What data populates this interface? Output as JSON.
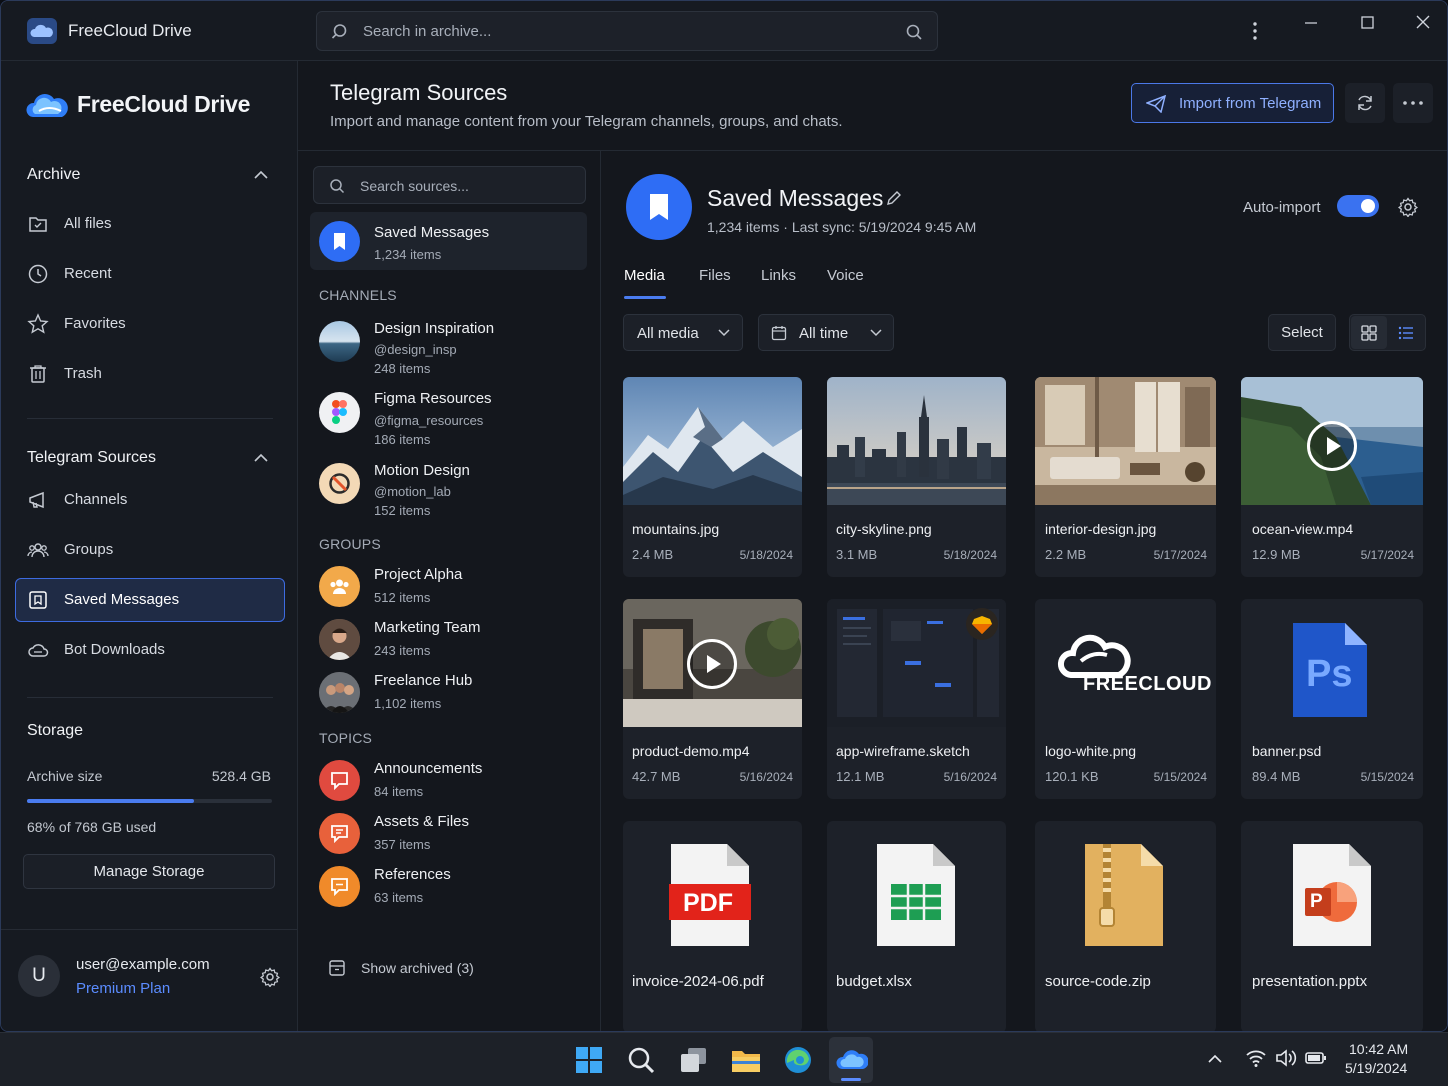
{
  "titlebar": {
    "app_name": "FreeCloud Drive",
    "search_placeholder": "Search in archive..."
  },
  "sidebar": {
    "brand": "FreeCloud Drive",
    "archive_heading": "Archive",
    "archive_items": [
      {
        "label": "All files",
        "icon": "folder-icon"
      },
      {
        "label": "Recent",
        "icon": "clock-icon"
      },
      {
        "label": "Favorites",
        "icon": "star-icon"
      },
      {
        "label": "Trash",
        "icon": "trash-icon"
      }
    ],
    "telegram_heading": "Telegram Sources",
    "telegram_items": [
      {
        "label": "Channels",
        "icon": "megaphone-icon"
      },
      {
        "label": "Groups",
        "icon": "groups-icon"
      },
      {
        "label": "Saved Messages",
        "icon": "bookmark-icon",
        "active": true
      },
      {
        "label": "Bot Downloads",
        "icon": "cloud-download-icon"
      }
    ],
    "storage": {
      "heading": "Storage",
      "archive_size_label": "Archive size",
      "archive_size_value": "528.4 GB",
      "used_fraction": 0.68,
      "used_text": "68% of 768 GB used",
      "manage_button": "Manage Storage"
    },
    "user": {
      "initial": "U",
      "email": "user@example.com",
      "plan": "Premium Plan"
    }
  },
  "header": {
    "title": "Telegram Sources",
    "subtitle": "Import and manage content from your Telegram channels, groups, and chats.",
    "import_button": "Import from Telegram"
  },
  "sources": {
    "search_placeholder": "Search sources...",
    "saved": {
      "name": "Saved Messages",
      "count": "1,234 items"
    },
    "channels_heading": "CHANNELS",
    "channels": [
      {
        "name": "Design Inspiration",
        "handle": "@design_insp",
        "count": "248 items"
      },
      {
        "name": "Figma Resources",
        "handle": "@figma_resources",
        "count": "186 items"
      },
      {
        "name": "Motion Design",
        "handle": "@motion_lab",
        "count": "152 items"
      }
    ],
    "groups_heading": "GROUPS",
    "groups": [
      {
        "name": "Project Alpha",
        "count": "512 items"
      },
      {
        "name": "Marketing Team",
        "count": "243 items"
      },
      {
        "name": "Freelance Hub",
        "count": "1,102 items"
      }
    ],
    "topics_heading": "TOPICS",
    "topics": [
      {
        "name": "Announcements",
        "count": "84 items",
        "color": "#e04a3f"
      },
      {
        "name": "Assets & Files",
        "count": "357 items",
        "color": "#e8613b"
      },
      {
        "name": "References",
        "count": "63 items",
        "color": "#f08a2a"
      }
    ],
    "show_archived": "Show archived (3)"
  },
  "detail": {
    "title": "Saved Messages",
    "meta": "1,234 items · Last sync: 5/19/2024 9:45 AM",
    "auto_import_label": "Auto-import",
    "auto_import_on": true,
    "tabs": [
      "Media",
      "Files",
      "Links",
      "Voice"
    ],
    "active_tab": "Media",
    "filter_media": "All media",
    "filter_time": "All time",
    "select_button": "Select",
    "view_mode": "grid"
  },
  "files": [
    {
      "name": "mountains.jpg",
      "size": "2.4 MB",
      "date": "5/18/2024",
      "kind": "image"
    },
    {
      "name": "city-skyline.png",
      "size": "3.1 MB",
      "date": "5/18/2024",
      "kind": "image"
    },
    {
      "name": "interior-design.jpg",
      "size": "2.2 MB",
      "date": "5/17/2024",
      "kind": "image"
    },
    {
      "name": "ocean-view.mp4",
      "size": "12.9 MB",
      "date": "5/17/2024",
      "kind": "video"
    },
    {
      "name": "product-demo.mp4",
      "size": "42.7 MB",
      "date": "5/16/2024",
      "kind": "video"
    },
    {
      "name": "app-wireframe.sketch",
      "size": "12.1 MB",
      "date": "5/16/2024",
      "kind": "sketch"
    },
    {
      "name": "logo-white.png",
      "size": "120.1 KB",
      "date": "5/15/2024",
      "kind": "logo",
      "logo_text": "FREECLOUD"
    },
    {
      "name": "banner.psd",
      "size": "89.4 MB",
      "date": "5/15/2024",
      "kind": "psd",
      "badge": "Ps"
    },
    {
      "name": "invoice-2024-06.pdf",
      "kind": "pdf",
      "badge": "PDF"
    },
    {
      "name": "budget.xlsx",
      "kind": "xlsx"
    },
    {
      "name": "source-code.zip",
      "kind": "zip"
    },
    {
      "name": "presentation.pptx",
      "kind": "pptx",
      "badge": "P"
    }
  ],
  "taskbar": {
    "time": "10:42 AM",
    "date": "5/19/2024"
  },
  "colors": {
    "accent": "#4a7cf0",
    "link": "#5b8cff",
    "background": "#14171d"
  }
}
